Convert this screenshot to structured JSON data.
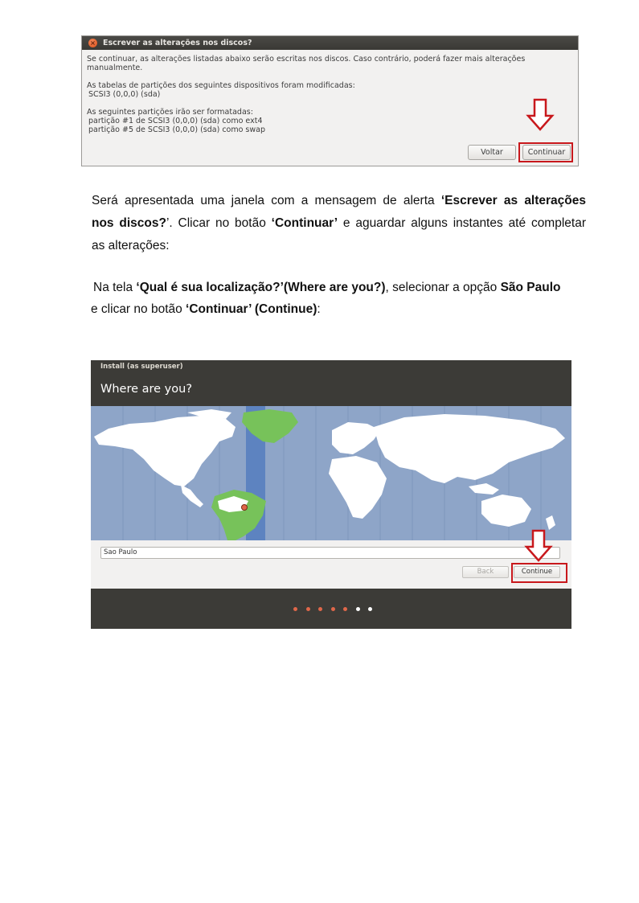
{
  "dialog": {
    "title": "Escrever as alterações nos discos?",
    "close_glyph": "×",
    "message": "Se continuar, as alterações listadas abaixo serão escritas nos discos. Caso contrário, poderá fazer mais alterações manualmente.",
    "tables_heading": "As tabelas de partições dos seguintes dispositivos foram modificadas:",
    "tables_device": "SCSI3 (0,0,0) (sda)",
    "format_heading": "As seguintes partições irão ser formatadas:",
    "format_items": [
      "partição #1 de SCSI3 (0,0,0) (sda) como ext4",
      "partição #5 de SCSI3 (0,0,0) (sda) como swap"
    ],
    "back_label": "Voltar",
    "continue_label": "Continuar"
  },
  "instructions": {
    "p1_line1_pre": "Será apresentada uma janela com a mensagem de alerta ",
    "p1_line1_bold": "‘Escrever as alterações",
    "p1_line2_bold1": "nos discos?",
    "p1_line2_mid": "’. Clicar no botão ",
    "p1_line2_bold2": "‘Continuar’",
    "p1_line2_post": " e aguardar alguns instantes até completar",
    "p1_line3": "as alterações:",
    "p2_line1_pre": "Na tela ",
    "p2_line1_bold1": "‘Qual é sua localização?’(Where are you?)",
    "p2_line1_mid": ", selecionar a opção ",
    "p2_line1_bold2": "São Paulo",
    "p2_line2_pre": "e clicar no botão ",
    "p2_line2_bold": "‘Continuar’ (Continue)",
    "p2_line2_post": ":"
  },
  "installer": {
    "window_title": "Install (as superuser)",
    "heading": "Where are you?",
    "location_value": "Sao Paulo",
    "back_label": "Back",
    "continue_label": "Continue",
    "progress": {
      "total_steps": 7,
      "completed_steps": 5
    }
  },
  "colors": {
    "highlight": "#c8181c",
    "ocean": "#8ea5c8",
    "land": "#ffffff",
    "selected_region": "#77c25a",
    "timezone_band": "#5d83c0",
    "progress_done": "#e0674a",
    "progress_todo": "#ffffff"
  },
  "icons": {
    "pointer_arrow": "down-arrow-icon",
    "map_pin": "location-pin-icon"
  }
}
